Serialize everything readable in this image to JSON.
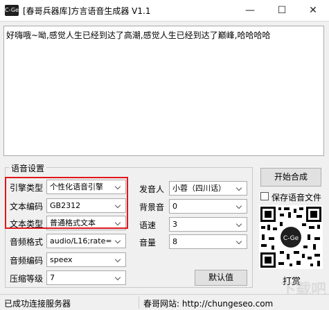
{
  "window": {
    "icon_text": "C-Ge",
    "title": "[春哥兵器库]方言语音生成器 V1.1",
    "min_glyph": "—",
    "max_glyph": "☐",
    "close_glyph": "✕"
  },
  "input_text": "好嗨哦~呦,感觉人生已经到达了高潮,感觉人生已经到达了巅峰,哈哈哈哈",
  "settings": {
    "group_title": "语音设置",
    "engine_label": "引擎类型",
    "engine_value": "个性化语音引擎",
    "text_encoding_label": "文本编码",
    "text_encoding_value": "GB2312",
    "text_type_label": "文本类型",
    "text_type_value": "普通格式文本",
    "audio_format_label": "音频格式",
    "audio_format_value": "audio/L16;rate=",
    "audio_encoding_label": "音频编码",
    "audio_encoding_value": "speex",
    "compression_label": "压缩等级",
    "compression_value": "7",
    "speaker_label": "发音人",
    "speaker_value": "小蓉（四川话）",
    "bg_sound_label": "背景音",
    "bg_sound_value": "0",
    "speed_label": "语速",
    "speed_value": "3",
    "volume_label": "音量",
    "volume_value": "8",
    "default_button": "默认值"
  },
  "actions": {
    "start_button": "开始合成",
    "save_checkbox_label": "保存语音文件",
    "reward_label": "打赏"
  },
  "qr": {
    "center_text": "C-Ge"
  },
  "watermark_text": "下载吧",
  "status": {
    "connection": "已成功连接服务器",
    "website": "春哥网站: http://chungeseo.com"
  },
  "colors": {
    "highlight": "#e0161b"
  }
}
